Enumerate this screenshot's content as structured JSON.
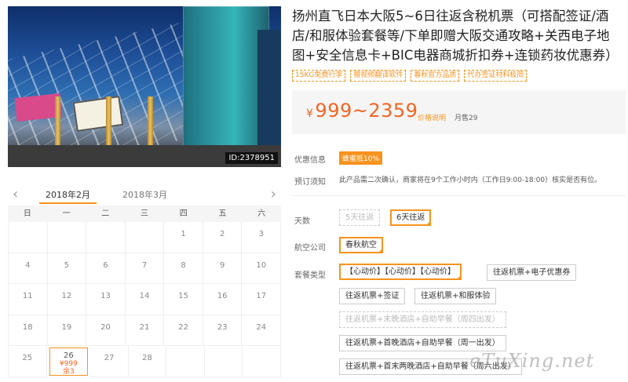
{
  "product": {
    "title": "扬州直飞日本大阪5~6日往返含税机票（可搭配签证/酒店/和服体验套餐等/下单即赠大阪交通攻略+关西电子地图+安全信息卡+BIC电器商城折扣券+连锁药妆优惠券）",
    "image_id": "ID:2378951",
    "tags": [
      "15KG免费行李",
      "赠视频翻译软件",
      "春秋官方品质",
      "代办签证材料极简"
    ],
    "price_symbol": "¥",
    "price_range": "999~2359",
    "price_note": "价格说明",
    "monthly_sales": "月售29"
  },
  "calendar": {
    "months": [
      "2018年2月",
      "2018年3月"
    ],
    "active_month": "2018年2月",
    "weekdays": [
      "日",
      "一",
      "二",
      "三",
      "四",
      "五",
      "六"
    ],
    "rows": [
      [
        "",
        "",
        "",
        "",
        "1",
        "2",
        "3"
      ],
      [
        "4",
        "5",
        "6",
        "7",
        "8",
        "9",
        "10"
      ],
      [
        "11",
        "12",
        "13",
        "14",
        "15",
        "16",
        "17"
      ],
      [
        "18",
        "19",
        "20",
        "21",
        "22",
        "23",
        "24"
      ],
      [
        "25",
        "26",
        "27",
        "28",
        "",
        "",
        ""
      ]
    ],
    "selected": {
      "day": "26",
      "price": "¥999",
      "remaining": "余3"
    }
  },
  "info": {
    "discount_label": "优惠信息",
    "discount_badge": "蜂蜜抵10%",
    "notice_label": "预订须知",
    "notice_text": "此产品需二次确认，商家将在9个工作小时内（工作日9:00-18:00）核实是否有位。"
  },
  "options": {
    "days_label": "天数",
    "days": [
      "5天往返",
      "6天往返"
    ],
    "airline_label": "航空公司",
    "airline": "春秋航空",
    "package_label": "套餐类型",
    "packages": [
      "【心动价】【心动价】【心动价】",
      "往返机票+电子优惠券",
      "往返机票+签证",
      "往返机票+和服体验",
      "往返机票+末晚酒店+自助早餐（周四出发）",
      "往返机票+首晚酒店+自助早餐（周一出发）",
      "往返机票+首末两晚酒店+自助早餐（周六出发）"
    ]
  },
  "watermark": "eTuXing.net",
  "colors": {
    "accent": "#f7931e",
    "price": "#f26522"
  }
}
